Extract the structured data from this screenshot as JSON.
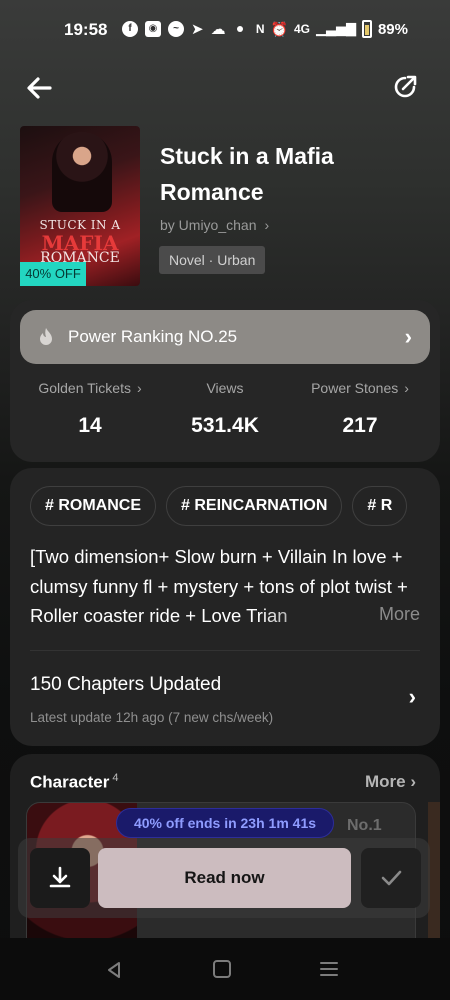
{
  "status_bar": {
    "time": "19:58",
    "network": "4G",
    "battery": "89%",
    "icons": [
      "facebook-icon",
      "discord-icon",
      "messenger-icon",
      "telegram-icon",
      "ghost-icon",
      "nfc-icon",
      "alarm-icon",
      "signal-icon",
      "battery-icon"
    ]
  },
  "header": {
    "back_icon": "arrow-left-icon",
    "share_icon": "share-icon"
  },
  "book": {
    "cover": {
      "line1": "STUCK IN A",
      "line2": "MAFIA",
      "line3": "ROMANCE"
    },
    "discount_badge": "40% OFF",
    "title": "Stuck in a Mafia Romance",
    "author": "by Umiyo_chan",
    "genre": "Novel · Urban"
  },
  "stats": {
    "ranking": "Power Ranking NO.25",
    "items": [
      {
        "label": "Golden Tickets",
        "value": "14"
      },
      {
        "label": "Views",
        "value": "531.4K"
      },
      {
        "label": "Power Stones",
        "value": "217"
      }
    ]
  },
  "details": {
    "tags": [
      "# ROMANCE",
      "# REINCARNATION",
      "# R"
    ],
    "synopsis": "[Two dimension+ Slow burn + Villain In love + clumsy funny fl + mystery + tons of plot twist + Roller coaster ride + Love Trian",
    "more": "More",
    "chapters_title": "150 Chapters Updated",
    "chapters_sub": "Latest update 12h ago (7 new chs/week)"
  },
  "character": {
    "title": "Character",
    "count": "4",
    "more": "More",
    "rank_label": "No.1"
  },
  "promo": {
    "text": "40% off ends in 23h 1m 41s"
  },
  "actions": {
    "read_label": "Read now"
  },
  "colors": {
    "accent_teal": "#23d6c1",
    "promo_bg": "#1a1a6a",
    "promo_text": "#8f9cff",
    "read_button": "#ccbcbf"
  }
}
